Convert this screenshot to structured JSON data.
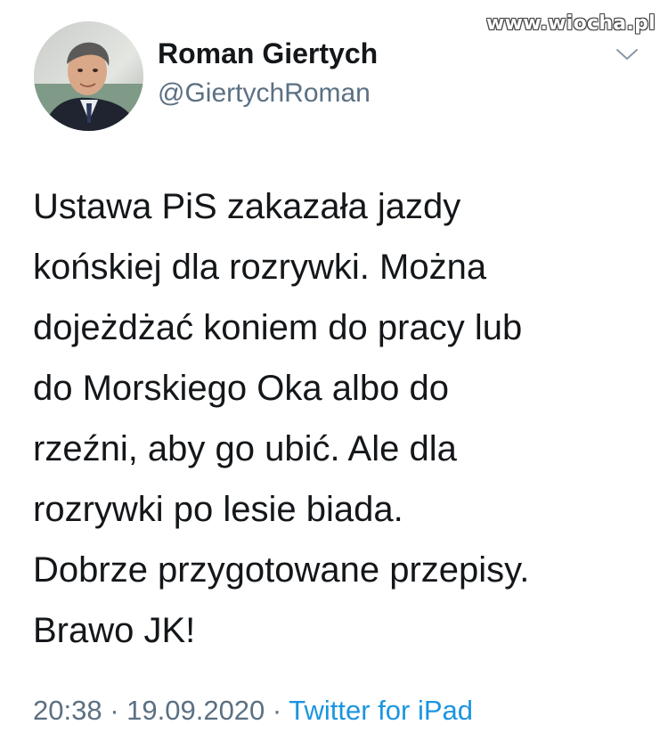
{
  "watermark": "www.wiocha.pl",
  "author": {
    "display_name": "Roman Giertych",
    "handle": "@GiertychRoman"
  },
  "tweet": {
    "lines": [
      "Ustawa PiS zakazała jazdy",
      "końskiej dla rozrywki. Można",
      "dojeżdżać koniem do pracy lub",
      "do Morskiego Oka albo do",
      "rzeźni, aby go ubić. Ale dla",
      "rozrywki po lesie biada.",
      "Dobrze przygotowane przepisy.",
      "Brawo JK!"
    ]
  },
  "meta": {
    "time": "20:38",
    "separator_1": " · ",
    "date": "19.09.2020",
    "separator_2": " · ",
    "source": "Twitter for iPad"
  },
  "colors": {
    "text": "#14171a",
    "secondary": "#5b7083",
    "link": "#1b95e0",
    "background": "#ffffff"
  },
  "icons": {
    "menu": "chevron-down-icon",
    "avatar": "profile-photo"
  }
}
